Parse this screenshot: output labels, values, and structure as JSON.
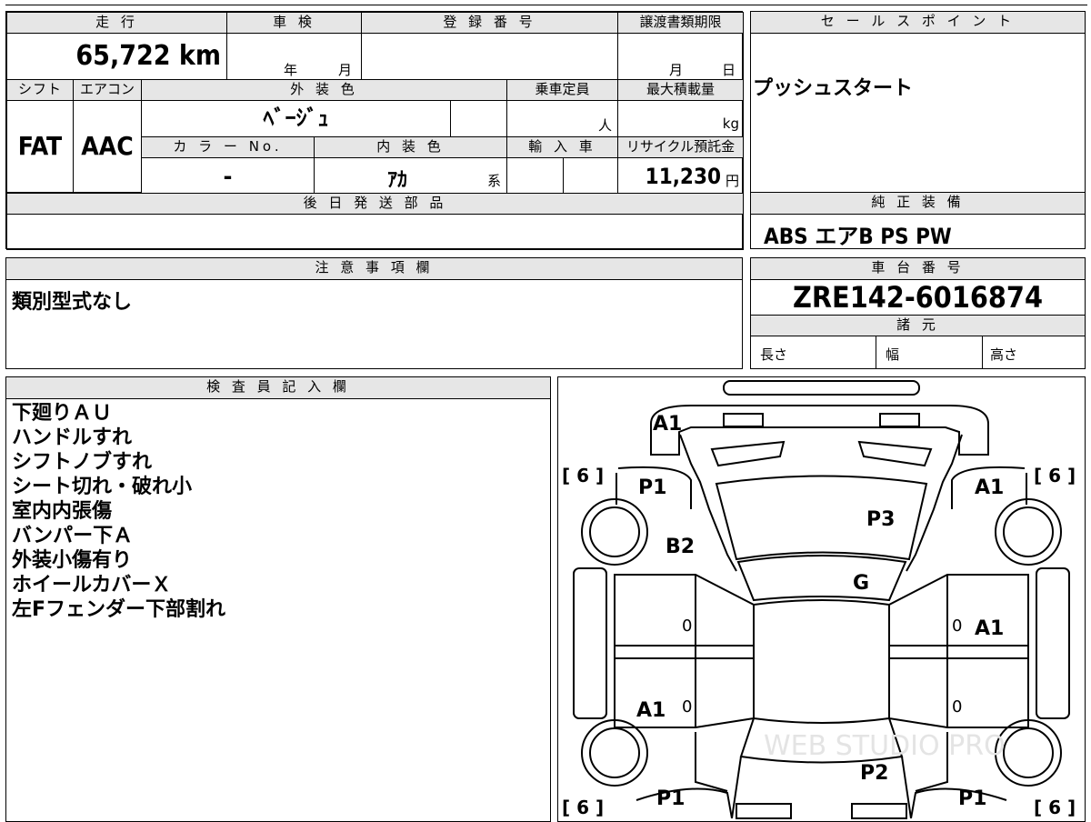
{
  "top_sheet": {
    "mileage_label": "走 行",
    "mileage_value": "65,722 km",
    "shaken_label": "車 検",
    "shaken_year": "年",
    "shaken_month": "月",
    "reg_no_label": "登 録 番 号",
    "transfer_label": "譲渡書類期限",
    "transfer_month": "月",
    "transfer_day": "日",
    "shift_label": "シフト",
    "shift_value": "FAT",
    "ac_label": "エアコン",
    "ac_value": "AAC",
    "ext_color_label": "外 装 色",
    "ext_color_value": "ﾍﾞｰｼﾞｭ",
    "capacity_label": "乗車定員",
    "capacity_unit": "人",
    "max_load_label": "最大積載量",
    "max_load_unit": "kg",
    "color_no_label": "カ ラ ー No.",
    "color_no_value": "-",
    "int_color_label": "内 装 色",
    "int_color_value": "ｱｶ",
    "int_color_suffix": "系",
    "import_label": "輸 入 車",
    "recycle_label": "リサイクル預託金",
    "recycle_value": "11,230",
    "recycle_unit": "円",
    "later_parts_label": "後 日 発 送 部 品"
  },
  "sales_point": {
    "label": "セ ー ル ス ポ イ ン ト",
    "value": "プッシュスタート"
  },
  "genuine_equipment": {
    "label": "純 正 装 備",
    "value": "ABS エアB PS PW"
  },
  "notes": {
    "label": "注 意 事 項 欄",
    "value": "類別型式なし"
  },
  "chassis": {
    "label": "車 台 番 号",
    "value": "ZRE142-6016874",
    "specs_label": "諸 元",
    "length_label": "長さ",
    "width_label": "幅",
    "height_label": "高さ"
  },
  "inspector": {
    "label": "検 査 員 記 入 欄",
    "lines": [
      "下廻りＡＵ",
      "ハンドルすれ",
      "シフトノブすれ",
      "シート切れ・破れ小",
      "室内内張傷",
      "バンパー下Ａ",
      "外装小傷有り",
      "ホイールカバーＸ",
      "左Fフェンダー下部割れ"
    ]
  },
  "diagram": {
    "marks": {
      "front_bumper": "A1",
      "hood": "P3",
      "windshield": "G",
      "front_left_fender": "P1",
      "left_a_pillar": "B2",
      "front_right_fender": "A1",
      "right_front_door": "A1",
      "left_rear_door": "A1",
      "roof": "P2",
      "rear_left": "P1",
      "rear_right": "P1"
    },
    "tire_tl": "[ 6 ]",
    "tire_tr": "[ 6 ]",
    "tire_bl": "[ 6 ]",
    "tire_br": "[ 6 ]",
    "zero": "0",
    "watermark": "WEB STUDIO PRO"
  }
}
